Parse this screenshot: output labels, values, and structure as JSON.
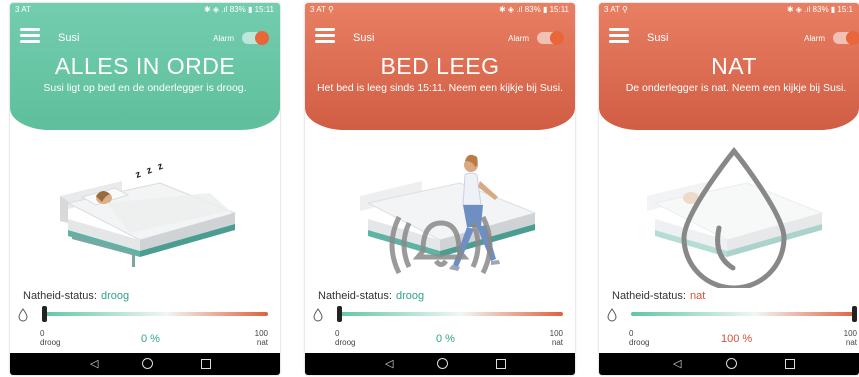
{
  "screens": [
    {
      "status_left": "3 AT",
      "status_right": "✱ ◈ .ıl 83% ▮ 15:11",
      "user": "Susi",
      "alarm_label": "Alarm",
      "alarm_on": true,
      "title": "ALLES IN ORDE",
      "subtitle": "Susi ligt op bed en de onderlegger is droog.",
      "status_label": "Natheid-status:",
      "status_value": "droog",
      "slider_min": "0",
      "slider_min_label": "droog",
      "slider_max": "100",
      "slider_max_label": "nat",
      "percent": "0 %",
      "wetness_fraction": 0,
      "sleep_text": "z z z",
      "header_color": "#5ebf9b",
      "status_color": "#2fa58a"
    },
    {
      "status_left": "3 AT ⚲",
      "status_right": "✱ ◈ .ıl 83% ▮ 15:11",
      "user": "Susi",
      "alarm_label": "Alarm",
      "alarm_on": true,
      "title": "BED LEEG",
      "subtitle": "Het bed is leeg sinds 15:11. Neem een kijkje bij Susi.",
      "status_label": "Natheid-status:",
      "status_value": "droog",
      "slider_min": "0",
      "slider_min_label": "droog",
      "slider_max": "100",
      "slider_max_label": "nat",
      "percent": "0 %",
      "wetness_fraction": 0,
      "header_color": "#d05d44",
      "status_color": "#2fa58a"
    },
    {
      "status_left": "3 AT ⚲",
      "status_right": "✱ ◈ .ıl 83% ▮ 15:1",
      "user": "Susi",
      "alarm_label": "Alarm",
      "alarm_on": true,
      "title": "NAT",
      "subtitle": "De onderlegger is nat. Neem een kijkje bij Susi.",
      "status_label": "Natheid-status:",
      "status_value": "nat",
      "slider_min": "0",
      "slider_min_label": "droog",
      "slider_max": "100",
      "slider_max_label": "nat",
      "percent": "100 %",
      "wetness_fraction": 1,
      "header_color": "#d05d44",
      "status_color": "#d0503a"
    }
  ],
  "nav": {
    "back": "◁",
    "home": "○",
    "recent": "□"
  },
  "colors": {
    "slider_start": "#5ec6a6",
    "slider_end": "#e0603e",
    "dry_text": "#2fa58a",
    "wet_text": "#d0503a"
  }
}
